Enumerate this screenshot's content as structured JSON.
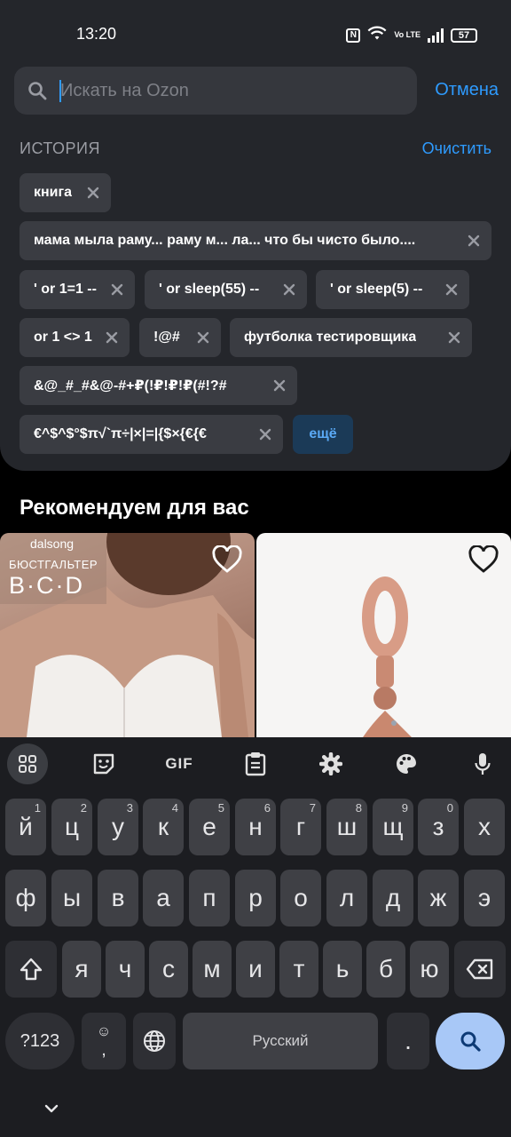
{
  "status_bar": {
    "time": "13:20",
    "nfc": "N",
    "volte": "Vo LTE",
    "battery": "57",
    "icons": [
      "nfc-icon",
      "wifi-icon",
      "volte-icon",
      "signal-icon",
      "battery-icon"
    ]
  },
  "search": {
    "placeholder": "Искать на Ozon",
    "value": "",
    "cancel_label": "Отмена"
  },
  "history": {
    "title": "ИСТОРИЯ",
    "clear_label": "Очистить",
    "items": [
      "книга",
      "мама мыла раму... раму м...  ла... что бы чисто было....",
      "' or 1=1 --",
      "' or sleep(55) --",
      "' or sleep(5) --",
      "or 1 <> 1",
      "!@#",
      "футболка тестировщика",
      "&@_#_#&@-#+₽(!₽!₽!₽(#!?#",
      "€^$^$°$π√`π÷|×|=|{$×{€{€"
    ],
    "more_label": "ещё"
  },
  "recommendations": {
    "title": "Рекомендуем для вас",
    "products": [
      {
        "brand": "dalsong",
        "badge_kind": "БЮСТГАЛЬТЕР",
        "badge_sizes": "B·C·D"
      },
      {
        "brand": "",
        "badge_kind": "",
        "badge_sizes": ""
      }
    ]
  },
  "keyboard": {
    "toolbar": [
      "apps-grid-icon",
      "sticker-icon",
      "GIF",
      "clipboard-icon",
      "settings-gear-icon",
      "theme-palette-icon",
      "microphone-icon"
    ],
    "row1": [
      [
        "й",
        "1"
      ],
      [
        "ц",
        "2"
      ],
      [
        "у",
        "3"
      ],
      [
        "к",
        "4"
      ],
      [
        "е",
        "5"
      ],
      [
        "н",
        "6"
      ],
      [
        "г",
        "7"
      ],
      [
        "ш",
        "8"
      ],
      [
        "щ",
        "9"
      ],
      [
        "з",
        "0"
      ],
      [
        "х",
        ""
      ]
    ],
    "row2": [
      "ф",
      "ы",
      "в",
      "а",
      "п",
      "р",
      "о",
      "л",
      "д",
      "ж",
      "э"
    ],
    "row3": [
      "я",
      "ч",
      "с",
      "м",
      "и",
      "т",
      "ь",
      "б",
      "ю"
    ],
    "mode_label": "?123",
    "emoji_hint": "☺",
    "comma_label": ",",
    "space_label": "Русский",
    "period_label": "."
  },
  "colors": {
    "accent": "#2e9bff",
    "panel": "#24262b",
    "chip": "#3a3c42",
    "search_key": "#a8c8f7"
  }
}
